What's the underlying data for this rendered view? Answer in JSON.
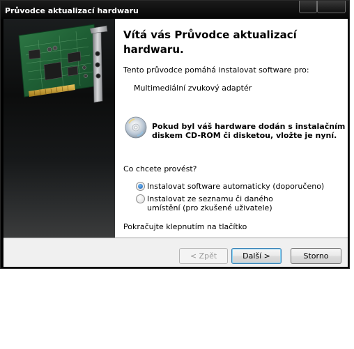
{
  "window": {
    "title": "Průvodce aktualizací hardwaru"
  },
  "wizard": {
    "heading": "Vítá vás Průvodce aktualizací hardwaru.",
    "heading_line1": "Vítá vás Průvodce aktualizací",
    "heading_line2": "hardwaru.",
    "intro": "Tento průvodce pomáhá instalovat software pro:",
    "device_name": "Multimediální zvukový adaptér",
    "cd_hint_line1": "Pokud byl váš hardware dodán s instalačním",
    "cd_hint_line2": "diskem CD-ROM či disketou, vložte je nyní.",
    "question": "Co chcete provést?",
    "options": [
      {
        "label": "Instalovat software automaticky (doporučeno)",
        "checked": true
      },
      {
        "label_line1": "Instalovat ze seznamu či daného",
        "label_line2": "umístění (pro zkušené uživatele)",
        "checked": false
      }
    ],
    "continue_hint": "Pokračujte klepnutím na tlačítko"
  },
  "buttons": {
    "back": "< Zpět",
    "next": "Další >",
    "cancel": "Storno"
  },
  "icons": {
    "hardware_image": "sound-card-image",
    "cd": "cd-rom-icon"
  }
}
